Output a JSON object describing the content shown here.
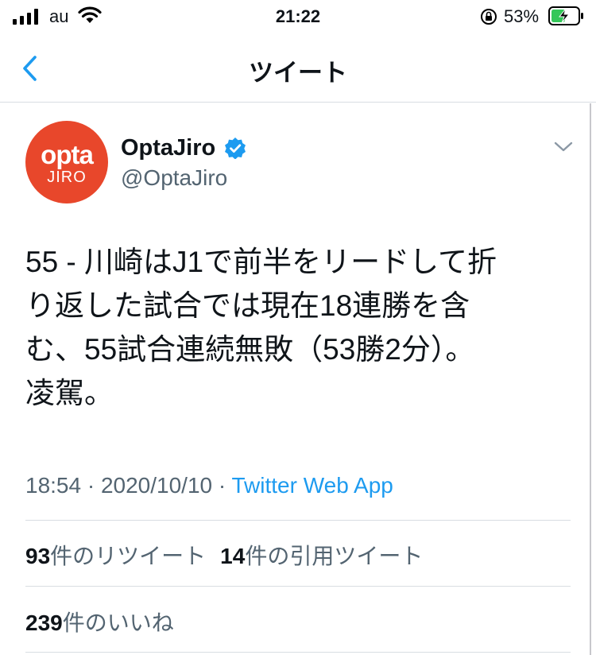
{
  "status_bar": {
    "carrier": "au",
    "time": "21:22",
    "battery_percent": "53%",
    "battery_level": 0.53,
    "icons": [
      "signal-icon",
      "wifi-icon",
      "orientation-lock-icon",
      "battery-charging-icon"
    ]
  },
  "nav": {
    "title": "ツイート",
    "back_icon": "chevron-left-icon"
  },
  "tweet": {
    "avatar_text_top": "opta",
    "avatar_text_bottom": "JIRO",
    "avatar_color": "#e8472b",
    "display_name": "OptaJiro",
    "verified": true,
    "handle": "@OptaJiro",
    "text": "55 - 川崎はJ1で前半をリードして折\nり返した試合では現在18連勝を含\nむ、55試合連続無敗（53勝2分）。\n凌駕。",
    "time": "18:54",
    "separator": "·",
    "date": "2020/10/10",
    "source": "Twitter Web App",
    "source_color": "#1d9bf0"
  },
  "stats": {
    "retweets_count": "93",
    "retweets_label": "件のリツイート",
    "quotes_count": "14",
    "quotes_label": "件の引用ツイート",
    "likes_count": "239",
    "likes_label": "件のいいね"
  }
}
